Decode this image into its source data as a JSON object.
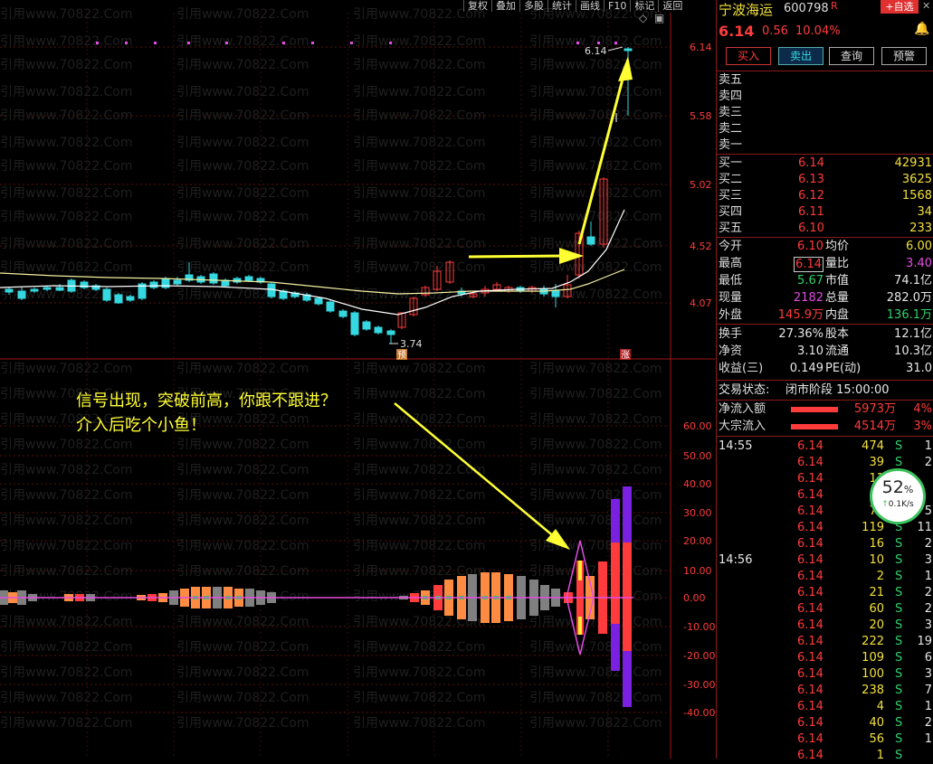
{
  "toolbar": [
    "复权",
    "叠加",
    "多股",
    "统计",
    "画线",
    "F10",
    "标记",
    "返回"
  ],
  "stock": {
    "name": "宁波海运",
    "code": "600798",
    "r_badge": "R",
    "add_btn": "+自选",
    "price": "6.14",
    "change": "0.56",
    "pct": "10.04%",
    "bell_icon": "bell-icon"
  },
  "actions": [
    "买入",
    "卖出",
    "查询",
    "预警"
  ],
  "asks": [
    "卖五",
    "卖四",
    "卖三",
    "卖二",
    "卖一"
  ],
  "bids": [
    {
      "label": "买一",
      "price": "6.14",
      "vol": "42931"
    },
    {
      "label": "买二",
      "price": "6.13",
      "vol": "3625"
    },
    {
      "label": "买三",
      "price": "6.12",
      "vol": "1568"
    },
    {
      "label": "买四",
      "price": "6.11",
      "vol": "34"
    },
    {
      "label": "买五",
      "price": "6.10",
      "vol": "233"
    }
  ],
  "stats": [
    {
      "l1": "今开",
      "v1": "6.10",
      "l2": "均价",
      "v2": "6.00"
    },
    {
      "l1": "最高",
      "v1": "6.14",
      "l2": "量比",
      "v2": "3.40"
    },
    {
      "l1": "最低",
      "v1": "5.67",
      "l2": "市值",
      "v2": "74.1亿"
    },
    {
      "l1": "现量",
      "v1": "2182",
      "l2": "总量",
      "v2": "282.0万"
    },
    {
      "l1": "外盘",
      "v1": "145.9万",
      "l2": "内盘",
      "v2": "136.1万"
    }
  ],
  "fund": [
    {
      "l1": "换手",
      "v1": "27.36%",
      "l2": "股本",
      "v2": "12.1亿"
    },
    {
      "l1": "净资",
      "v1": "3.10",
      "l2": "流通",
      "v2": "10.3亿"
    },
    {
      "l1": "收益(三)",
      "v1": "0.149",
      "l2": "PE(动)",
      "v2": "31.0"
    }
  ],
  "trade_status": {
    "label": "交易状态:",
    "value": "闭市阶段 15:00:00"
  },
  "flows": [
    {
      "label": "净流入额",
      "value": "5973万",
      "pct": "4%"
    },
    {
      "label": "大宗流入",
      "value": "4514万",
      "pct": "3%"
    }
  ],
  "ticks_1455": {
    "time": "14:55",
    "rows": [
      [
        "6.14",
        "474",
        "S",
        "1"
      ],
      [
        "6.14",
        "39",
        "S",
        "2"
      ],
      [
        "6.14",
        "11",
        "S",
        ""
      ],
      [
        "6.14",
        "",
        "S",
        ""
      ],
      [
        "6.14",
        "70",
        "S",
        "5"
      ],
      [
        "6.14",
        "119",
        "S",
        "11"
      ],
      [
        "6.14",
        "16",
        "S",
        "2"
      ]
    ]
  },
  "ticks_1456": {
    "time": "14:56",
    "rows": [
      [
        "6.14",
        "10",
        "S",
        "3"
      ],
      [
        "6.14",
        "2",
        "S",
        "1"
      ],
      [
        "6.14",
        "21",
        "S",
        "2"
      ],
      [
        "6.14",
        "60",
        "S",
        "2"
      ],
      [
        "6.14",
        "20",
        "S",
        "3"
      ],
      [
        "6.14",
        "222",
        "S",
        "19"
      ],
      [
        "6.14",
        "109",
        "S",
        "6"
      ],
      [
        "6.14",
        "100",
        "S",
        "3"
      ],
      [
        "6.14",
        "238",
        "S",
        "7"
      ],
      [
        "6.14",
        "4",
        "S",
        "1"
      ],
      [
        "6.14",
        "40",
        "S",
        "2"
      ],
      [
        "6.14",
        "56",
        "S",
        "1"
      ],
      [
        "6.14",
        "1",
        "S",
        ""
      ]
    ]
  },
  "speed": {
    "pct": "52",
    "unit": "%",
    "rate": "0.1K/s"
  },
  "price_axis": [
    "6.14",
    "5.58",
    "5.02",
    "4.52",
    "4.07"
  ],
  "osc_axis": [
    "60.00",
    "50.00",
    "40.00",
    "30.00",
    "20.00",
    "10.00",
    "0.00",
    "-10.00",
    "-20.00",
    "-30.00",
    "-40.00"
  ],
  "markers": {
    "low_label": "3.74",
    "high_label": "6.14",
    "pre_tag": "预",
    "zhang_tag": "涨"
  },
  "annotation": {
    "line1": "信号出现，突破前高，你跟不跟进？",
    "line2": "介入后吃个小鱼！"
  },
  "watermark": "引用www.70822.Com",
  "colors": {
    "up": "#ff3b3b",
    "down": "#35d8e0",
    "ma5": "#f2f0a0",
    "ma10": "#ffffff",
    "arrow": "#ffff33",
    "osc_line": "#e34ce3"
  }
}
